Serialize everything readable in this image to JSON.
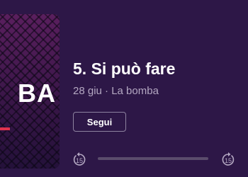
{
  "episode": {
    "cover_text": "BA",
    "title": "5. Si può fare",
    "meta": "28 giu · La bomba"
  },
  "actions": {
    "follow_label": "Segui"
  },
  "player": {
    "skip_back_seconds": "15",
    "skip_forward_seconds": "15",
    "progress_fraction": 0
  },
  "colors": {
    "background": "#2d1747",
    "accent": "#e0334e",
    "secondary_text": "#b4a8c2"
  }
}
